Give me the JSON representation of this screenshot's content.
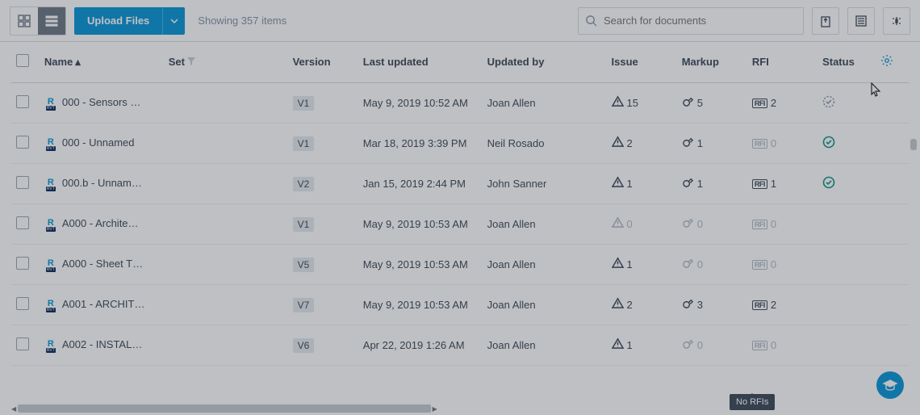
{
  "toolbar": {
    "upload_label": "Upload Files",
    "count_text": "Showing 357 items",
    "search_placeholder": "Search for documents"
  },
  "columns": {
    "name": "Name",
    "set": "Set",
    "version": "Version",
    "updated": "Last updated",
    "by": "Updated by",
    "issue": "Issue",
    "markup": "Markup",
    "rfi": "RFI",
    "status": "Status"
  },
  "rows": [
    {
      "name": "000 - Sensors …",
      "ver": "V1",
      "updated": "May 9, 2019 10:52 AM",
      "by": "Joan Allen",
      "issue": "15",
      "issue_muted": false,
      "markup": "5",
      "markup_muted": false,
      "rfi": "2",
      "rfi_muted": false,
      "status": "pending"
    },
    {
      "name": "000 - Unnamed",
      "ver": "V1",
      "updated": "Mar 18, 2019 3:39 PM",
      "by": "Neil Rosado",
      "issue": "2",
      "issue_muted": false,
      "markup": "1",
      "markup_muted": false,
      "rfi": "0",
      "rfi_muted": true,
      "status": "ok"
    },
    {
      "name": "000.b - Unnam…",
      "ver": "V2",
      "updated": "Jan 15, 2019 2:44 PM",
      "by": "John Sanner",
      "issue": "1",
      "issue_muted": false,
      "markup": "1",
      "markup_muted": false,
      "rfi": "1",
      "rfi_muted": false,
      "status": "ok"
    },
    {
      "name": "A000 - Archite…",
      "ver": "V1",
      "updated": "May 9, 2019 10:53 AM",
      "by": "Joan Allen",
      "issue": "0",
      "issue_muted": true,
      "markup": "0",
      "markup_muted": true,
      "rfi": "0",
      "rfi_muted": true,
      "status": ""
    },
    {
      "name": "A000 - Sheet T…",
      "ver": "V5",
      "updated": "May 9, 2019 10:53 AM",
      "by": "Joan Allen",
      "issue": "1",
      "issue_muted": false,
      "markup": "0",
      "markup_muted": true,
      "rfi": "0",
      "rfi_muted": true,
      "status": ""
    },
    {
      "name": "A001 - ARCHIT…",
      "ver": "V7",
      "updated": "May 9, 2019 10:53 AM",
      "by": "Joan Allen",
      "issue": "2",
      "issue_muted": false,
      "markup": "3",
      "markup_muted": false,
      "rfi": "2",
      "rfi_muted": false,
      "status": ""
    },
    {
      "name": "A002 - INSTAL…",
      "ver": "V6",
      "updated": "Apr 22, 2019 1:26 AM",
      "by": "Joan Allen",
      "issue": "1",
      "issue_muted": false,
      "markup": "0",
      "markup_muted": true,
      "rfi": "0",
      "rfi_muted": true,
      "status": ""
    }
  ],
  "tooltip": "No RFIs"
}
